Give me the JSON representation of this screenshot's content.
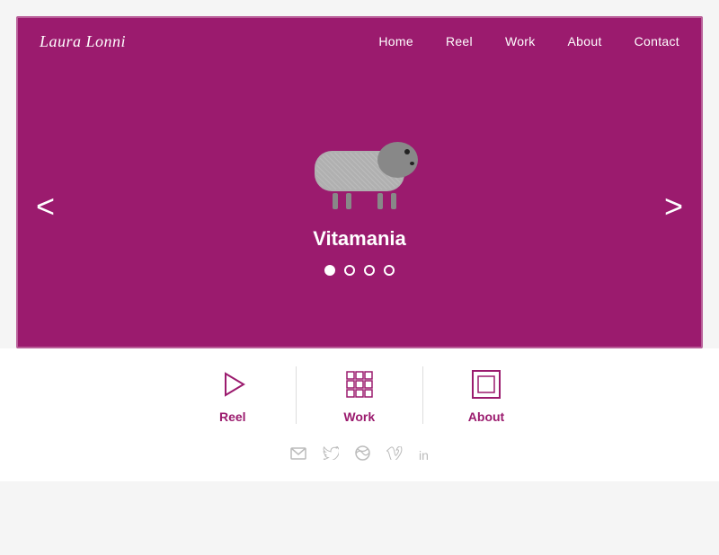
{
  "site": {
    "logo": "Laura Lonni"
  },
  "nav": {
    "links": [
      {
        "label": "Home",
        "id": "home"
      },
      {
        "label": "Reel",
        "id": "reel"
      },
      {
        "label": "Work",
        "id": "work"
      },
      {
        "label": "About",
        "id": "about"
      },
      {
        "label": "Contact",
        "id": "contact"
      }
    ]
  },
  "carousel": {
    "title": "Vitamania",
    "dots": [
      {
        "active": true
      },
      {
        "active": false
      },
      {
        "active": false
      },
      {
        "active": false
      }
    ],
    "prev_arrow": "<",
    "next_arrow": ">"
  },
  "bottom_items": [
    {
      "label": "Reel",
      "icon": "play-icon"
    },
    {
      "label": "Work",
      "icon": "grid-icon"
    },
    {
      "label": "About",
      "icon": "frame-icon"
    }
  ],
  "social_icons": [
    {
      "name": "email-icon",
      "symbol": "✉"
    },
    {
      "name": "twitter-icon",
      "symbol": "𝕋"
    },
    {
      "name": "dribbble-icon",
      "symbol": "⊕"
    },
    {
      "name": "vimeo-icon",
      "symbol": "𝕍"
    },
    {
      "name": "linkedin-icon",
      "symbol": "in"
    }
  ]
}
